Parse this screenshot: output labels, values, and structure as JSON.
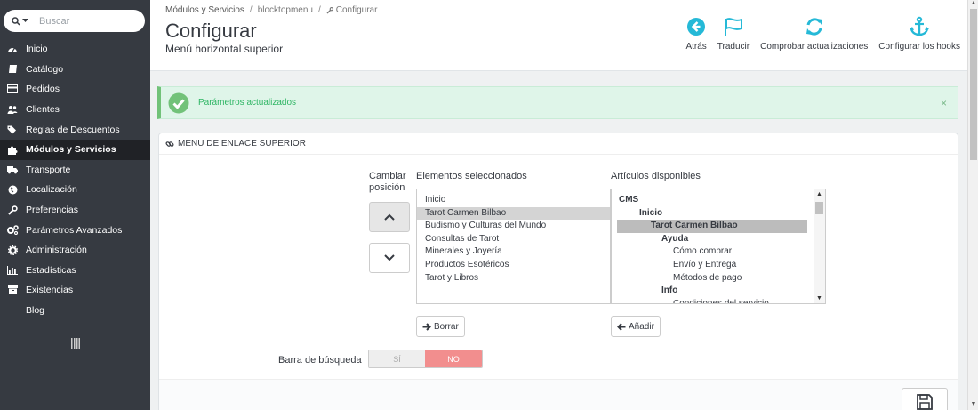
{
  "sidebar": {
    "search_dropdown": "Q",
    "search_placeholder": "Buscar",
    "items": [
      {
        "label": "Inicio",
        "icon": "dashboard-icon"
      },
      {
        "label": "Catálogo",
        "icon": "book-icon"
      },
      {
        "label": "Pedidos",
        "icon": "credit-card-icon"
      },
      {
        "label": "Clientes",
        "icon": "users-icon"
      },
      {
        "label": "Reglas de Descuentos",
        "icon": "tags-icon"
      },
      {
        "label": "Módulos y Servicios",
        "icon": "puzzle-icon"
      },
      {
        "label": "Transporte",
        "icon": "truck-icon"
      },
      {
        "label": "Localización",
        "icon": "globe-icon"
      },
      {
        "label": "Preferencias",
        "icon": "wrench-icon"
      },
      {
        "label": "Parámetros Avanzados",
        "icon": "cogs-icon"
      },
      {
        "label": "Administración",
        "icon": "cog-icon"
      },
      {
        "label": "Estadísticas",
        "icon": "bar-chart-icon"
      },
      {
        "label": "Existencias",
        "icon": "archive-icon"
      },
      {
        "label": "Blog",
        "icon": ""
      }
    ],
    "active_index": 5
  },
  "header": {
    "breadcrumb": [
      "Módulos y Servicios",
      "blocktopmenu",
      "Configurar"
    ],
    "title": "Configurar",
    "subtitle": "Menú horizontal superior",
    "toolbar": [
      {
        "label": "Atrás",
        "icon": "arrow-circle-left-icon"
      },
      {
        "label": "Traducir",
        "icon": "flag-icon"
      },
      {
        "label": "Comprobar actualizaciones",
        "icon": "refresh-icon"
      },
      {
        "label": "Configurar los hooks",
        "icon": "anchor-icon"
      }
    ]
  },
  "alert": {
    "text": "Parámetros actualizados",
    "close": "×"
  },
  "panel": {
    "title": "MENU DE ENLACE SUPERIOR",
    "change_position_label": "Cambiar posición",
    "selected_header": "Elementos seleccionados",
    "available_header": "Artículos disponibles",
    "selected_items": [
      "Inicio",
      "Tarot Carmen Bilbao",
      "Budismo y Culturas del Mundo",
      "Consultas de Tarot",
      "Minerales y Joyería",
      "Productos Esotéricos",
      "Tarot y Libros"
    ],
    "selected_active_index": 1,
    "available_items": [
      {
        "label": "CMS",
        "level": 0,
        "bold": true
      },
      {
        "label": "Inicio",
        "level": 1,
        "bold": true
      },
      {
        "label": "Tarot Carmen Bilbao",
        "level": 2,
        "bold": true,
        "selected": true
      },
      {
        "label": "Ayuda",
        "level": 3,
        "bold": true
      },
      {
        "label": "Cómo comprar",
        "level": 4,
        "bold": false
      },
      {
        "label": "Envío y Entrega",
        "level": 4,
        "bold": false
      },
      {
        "label": "Métodos de pago",
        "level": 4,
        "bold": false
      },
      {
        "label": "Info",
        "level": 3,
        "bold": true
      },
      {
        "label": "Condiciones del servicio",
        "level": 4,
        "bold": false
      }
    ],
    "remove_label": "Borrar",
    "add_label": "Añadir",
    "search_bar_label": "Barra de búsqueda",
    "toggle_yes": "SÍ",
    "toggle_no": "NO"
  },
  "colors": {
    "sidebar_bg": "#363a41",
    "accent": "#25b9d7",
    "success": "#72c279",
    "toggle_no": "#f28e8e"
  }
}
